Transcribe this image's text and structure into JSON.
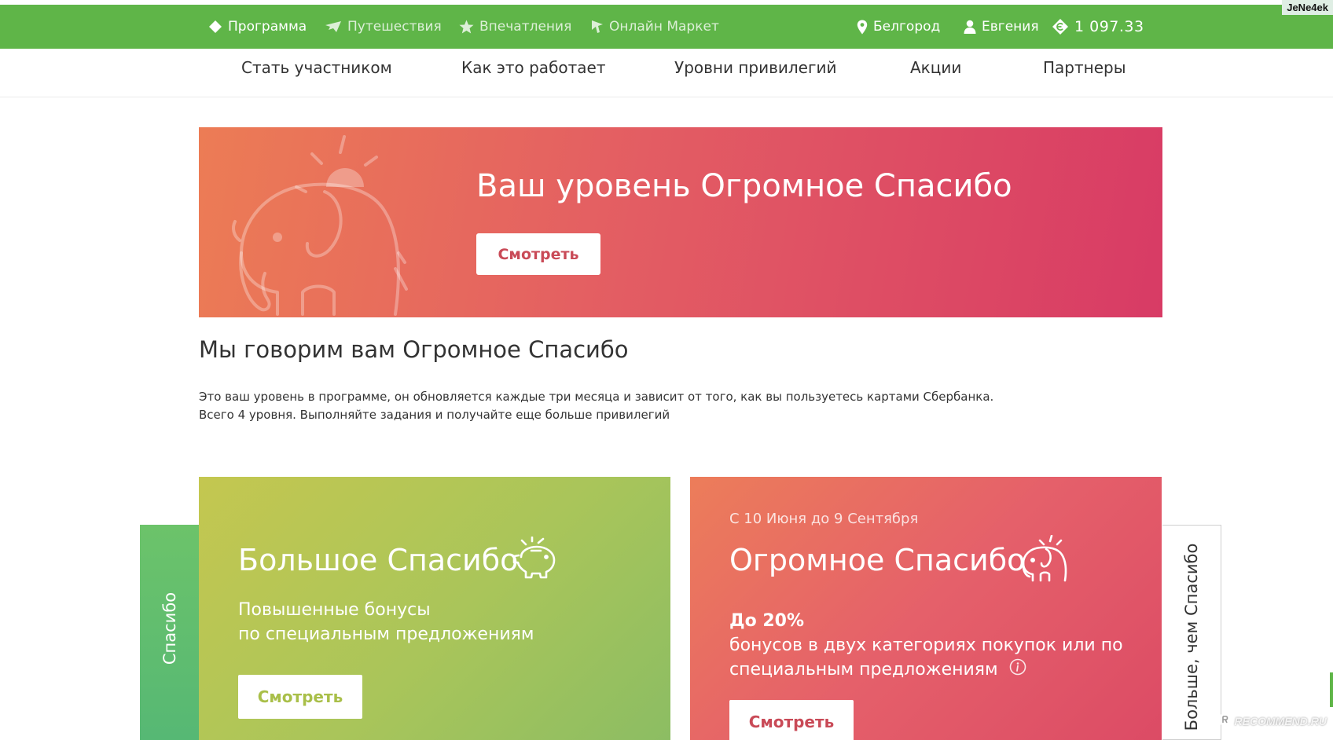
{
  "topbar": {
    "items": [
      {
        "label": "Программа",
        "icon": "diamond-icon"
      },
      {
        "label": "Путешествия",
        "icon": "plane-icon"
      },
      {
        "label": "Впечатления",
        "icon": "star-icon"
      },
      {
        "label": "Онлайн Маркет",
        "icon": "cursor-icon"
      }
    ],
    "city": "Белгород",
    "user": "Евгения",
    "balance": "1 097.33",
    "colors": {
      "bar": "#5fb548"
    }
  },
  "subnav": {
    "links": [
      "Стать участником",
      "Как это работает",
      "Уровни привилегий",
      "Акции",
      "Партнеры"
    ]
  },
  "hero": {
    "title": "Ваш уровень Огромное Спасибо",
    "button": "Смотреть",
    "icon": "elephant-icon"
  },
  "intro": {
    "title": "Мы говорим вам Огромное Спасибо",
    "line1": "Это ваш уровень в программе, он обновляется каждые три месяца и зависит от того, как вы пользуетесь картами Сбербанка.",
    "line2": "Всего 4 уровня. Выполняйте задания и получайте еще больше привилегий"
  },
  "levels": {
    "left_tab": "Спасибо",
    "right_tab": "Больше, чем Спасибо",
    "cards": [
      {
        "title": "Большое Спасибо",
        "icon": "piggy-bank-icon",
        "desc_line1": "Повышенные бонусы",
        "desc_line2": "по специальным предложениям",
        "button": "Смотреть"
      },
      {
        "date": "С 10 Июня до 9 Сентября",
        "title": "Огромное Спасибо",
        "icon": "elephant-icon",
        "highlight": "До 20%",
        "desc_line1": "бонусов в двух категориях покупок или по",
        "desc_line2": "специальным предложениям",
        "button": "Смотреть"
      }
    ]
  },
  "watermarks": {
    "top": "JeNe4ek",
    "bottom": "RECOMMEND.RU"
  }
}
